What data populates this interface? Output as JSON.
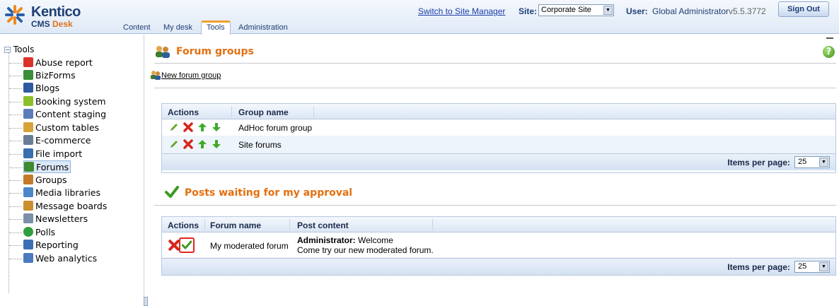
{
  "header": {
    "logo_brand": "Kentico",
    "logo_product_1": "CMS",
    "logo_product_2": "Desk",
    "switch_link": "Switch to Site Manager",
    "site_label": "Site:",
    "site_value": "Corporate Site",
    "user_label": "User:",
    "user_name": "Global Administrator",
    "version": "v5.5.3772",
    "sign_out": "Sign Out",
    "tabs": [
      {
        "label": "Content"
      },
      {
        "label": "My desk"
      },
      {
        "label": "Tools",
        "active": true
      },
      {
        "label": "Administration"
      }
    ]
  },
  "sidebar": {
    "root": "Tools",
    "items": [
      {
        "label": "Abuse report",
        "icon": "abuse-report-icon",
        "color": "#d9342b"
      },
      {
        "label": "BizForms",
        "icon": "bizforms-icon",
        "color": "#3a8d3a"
      },
      {
        "label": "Blogs",
        "icon": "blogs-icon",
        "color": "#2c5aa0"
      },
      {
        "label": "Booking system",
        "icon": "booking-system-icon",
        "color": "#8bbf2a"
      },
      {
        "label": "Content staging",
        "icon": "content-staging-icon",
        "color": "#5a7fb8"
      },
      {
        "label": "Custom tables",
        "icon": "custom-tables-icon",
        "color": "#d6a23a"
      },
      {
        "label": "E-commerce",
        "icon": "ecommerce-icon",
        "color": "#6b7c95"
      },
      {
        "label": "File import",
        "icon": "file-import-icon",
        "color": "#3a6fb0"
      },
      {
        "label": "Forums",
        "icon": "forums-icon",
        "color": "#3f8a2f",
        "selected": true
      },
      {
        "label": "Groups",
        "icon": "groups-icon",
        "color": "#c27a2a"
      },
      {
        "label": "Media libraries",
        "icon": "media-libraries-icon",
        "color": "#4a86c8"
      },
      {
        "label": "Message boards",
        "icon": "message-boards-icon",
        "color": "#c98f2f"
      },
      {
        "label": "Newsletters",
        "icon": "newsletters-icon",
        "color": "#7c8fa8"
      },
      {
        "label": "Polls",
        "icon": "polls-icon",
        "color": "#2f9e3e"
      },
      {
        "label": "Reporting",
        "icon": "reporting-icon",
        "color": "#3d6fb5"
      },
      {
        "label": "Web analytics",
        "icon": "web-analytics-icon",
        "color": "#4a7ac0"
      }
    ]
  },
  "forum_groups": {
    "title": "Forum groups",
    "new_link": "New forum group",
    "columns": [
      "Actions",
      "Group name"
    ],
    "rows": [
      {
        "name": "AdHoc forum group"
      },
      {
        "name": "Site forums"
      }
    ],
    "items_per_page_label": "Items per page:",
    "items_per_page": "25"
  },
  "posts_approval": {
    "title": "Posts waiting for my approval",
    "columns": [
      "Actions",
      "Forum name",
      "Post content"
    ],
    "rows": [
      {
        "forum": "My moderated forum",
        "author": "Administrator:",
        "subject": "Welcome",
        "body": "Come try our new moderated forum."
      }
    ],
    "items_per_page_label": "Items per page:",
    "items_per_page": "25"
  },
  "colors": {
    "title_orange": "#e46f0f",
    "header_blue": "#1f3f75",
    "highlight_red": "#e2261c"
  }
}
